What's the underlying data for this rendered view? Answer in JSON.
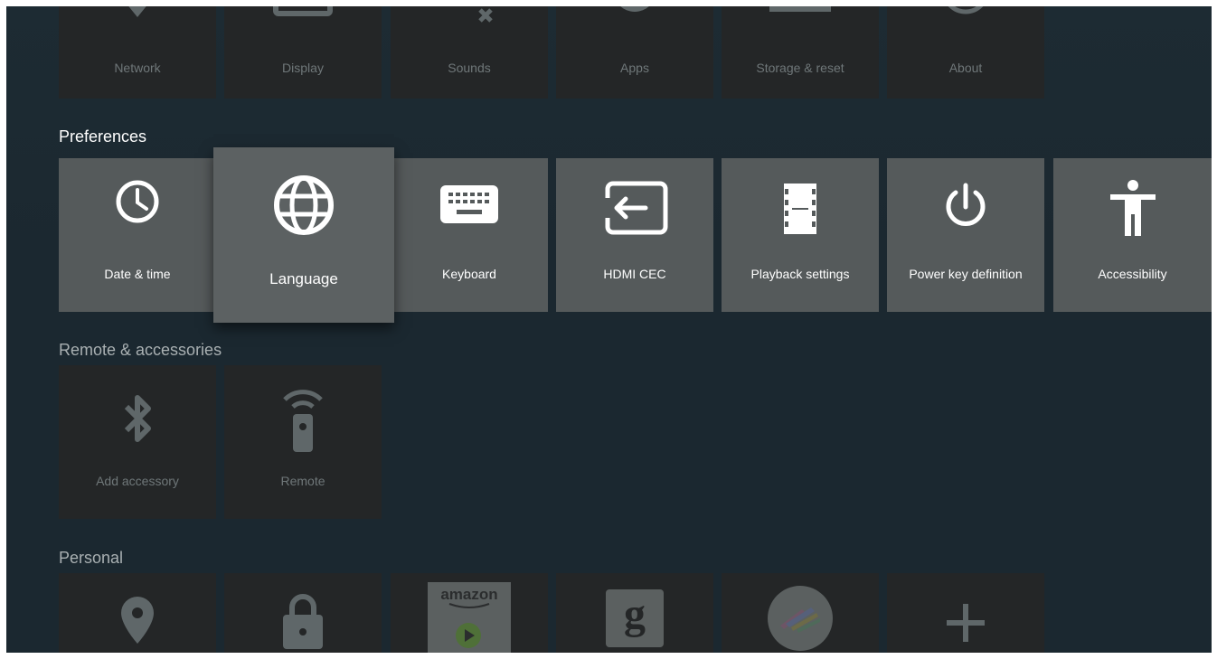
{
  "colors": {
    "background": "#1b2830",
    "dim_tile": "#242627",
    "preference_tile": "#555a5b",
    "focused_tile": "#5c6162",
    "icon_white": "#ffffff",
    "icon_dim": "#5f6769"
  },
  "device": {
    "items": [
      {
        "label": "Network",
        "icon": "wifi-icon"
      },
      {
        "label": "Display",
        "icon": "display-icon"
      },
      {
        "label": "Sounds",
        "icon": "sound-mute-icon"
      },
      {
        "label": "Apps",
        "icon": "apps-icon"
      },
      {
        "label": "Storage & reset",
        "icon": "storage-icon"
      },
      {
        "label": "About",
        "icon": "info-icon"
      }
    ]
  },
  "preferences": {
    "title": "Preferences",
    "items": [
      {
        "label": "Date & time",
        "icon": "clock-icon"
      },
      {
        "label": "Language",
        "icon": "globe-icon",
        "focused": true
      },
      {
        "label": "Keyboard",
        "icon": "keyboard-icon"
      },
      {
        "label": "HDMI CEC",
        "icon": "input-icon"
      },
      {
        "label": "Playback settings",
        "icon": "film-icon"
      },
      {
        "label": "Power key definition",
        "icon": "power-icon"
      },
      {
        "label": "Accessibility",
        "icon": "accessibility-icon"
      }
    ]
  },
  "remote": {
    "title": "Remote & accessories",
    "items": [
      {
        "label": "Add accessory",
        "icon": "bluetooth-icon"
      },
      {
        "label": "Remote",
        "icon": "remote-icon"
      }
    ]
  },
  "personal": {
    "title": "Personal",
    "items": [
      {
        "icon": "location-icon"
      },
      {
        "icon": "lock-icon"
      },
      {
        "icon": "amazon-video-icon",
        "logo_text": "amazon"
      },
      {
        "icon": "google-icon",
        "logo_text": "g"
      },
      {
        "icon": "app-logo-icon"
      },
      {
        "icon": "add-icon"
      }
    ]
  }
}
